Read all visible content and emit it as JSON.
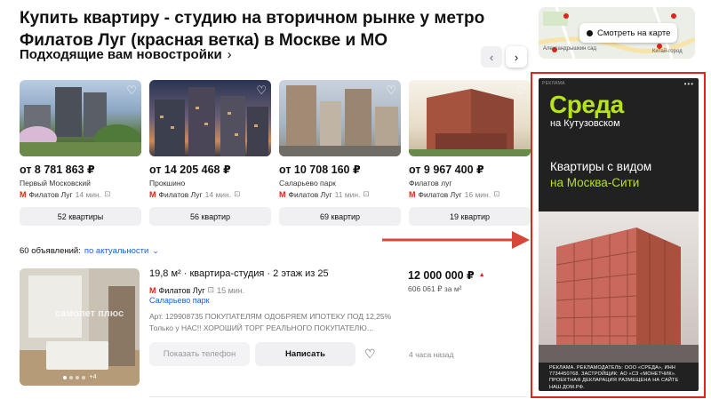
{
  "header": {
    "title": "Купить квартиру - студию на вторичном рынке у метро Филатов Луг (красная ветка) в Москве и МО",
    "subtitle": "Подходящие вам новостройки",
    "subtitle_icon": "chevron-right-icon",
    "prev_icon": "chevron-left-icon",
    "next_icon": "chevron-right-icon"
  },
  "map": {
    "button_label": "Смотреть на карте",
    "label_1": "Александрышкин сад",
    "label_2": "Китай-город"
  },
  "new_buildings": [
    {
      "price": "от 8 781 863 ₽",
      "name": "Первый Московский",
      "metro": "Филатов Луг",
      "minutes": "14 мин.",
      "count": "52 квартиры"
    },
    {
      "price": "от 14 205 468 ₽",
      "name": "Прокшино",
      "metro": "Филатов Луг",
      "minutes": "14 мин.",
      "count": "56 квартир"
    },
    {
      "price": "от 10 708 160 ₽",
      "name": "Саларьево парк",
      "metro": "Филатов Луг",
      "minutes": "11 мин.",
      "count": "69 квартир"
    },
    {
      "price": "от 9 967 400 ₽",
      "name": "Филатов луг",
      "metro": "Филатов Луг",
      "minutes": "16 мин.",
      "count": "19 квартир"
    }
  ],
  "listings_header": {
    "count": "60 объявлений:",
    "sort": "по актуальности"
  },
  "listing": {
    "title": "19,8 м² · квартира-студия · 2 этаж из 25",
    "metro": "Филатов Луг",
    "minutes": "15 мин.",
    "district": "Саларьево парк",
    "description": "Арт. 129908735 ПОКУПАТЕЛЯМ ОДОБРЯЕМ ИПОТЕКУ ПОД 12,25% Только у НАС!! ХОРОШИЙ ТОРГ РЕАЛЬНОГО ПОКУПАТЕЛЮ...",
    "price": "12 000 000 ₽",
    "price_per_m2": "606 061 ₽ за м²",
    "phone_button": "Показать телефон",
    "write_button": "Написать",
    "time": "4 часа назад",
    "photo_watermark": "самолет плюс",
    "photo_more": "+4"
  },
  "ad": {
    "tag": "РЕКЛАМА",
    "brand": "Среда",
    "brand_sub": "на Кутузовском",
    "headline_1": "Квартиры с видом",
    "headline_2": "на Москва-Сити",
    "legal": "РЕКЛАМА. РЕКЛАМОДАТЕЛЬ: ООО «СРЕДА», ИНН 7734450768. ЗАСТРОЙЩИК: АО «СЗ «МОНЕТЧИК». ПРОЕКТНАЯ ДЕКЛАРАЦИЯ РАЗМЕЩЕНА НА САЙТЕ НАШ.ДОМ.РФ."
  },
  "colors": {
    "metro_red": "#e0241b",
    "link_blue": "#1a5fd1",
    "ad_green": "#b6e21f",
    "annotation_red": "#d9463a"
  }
}
